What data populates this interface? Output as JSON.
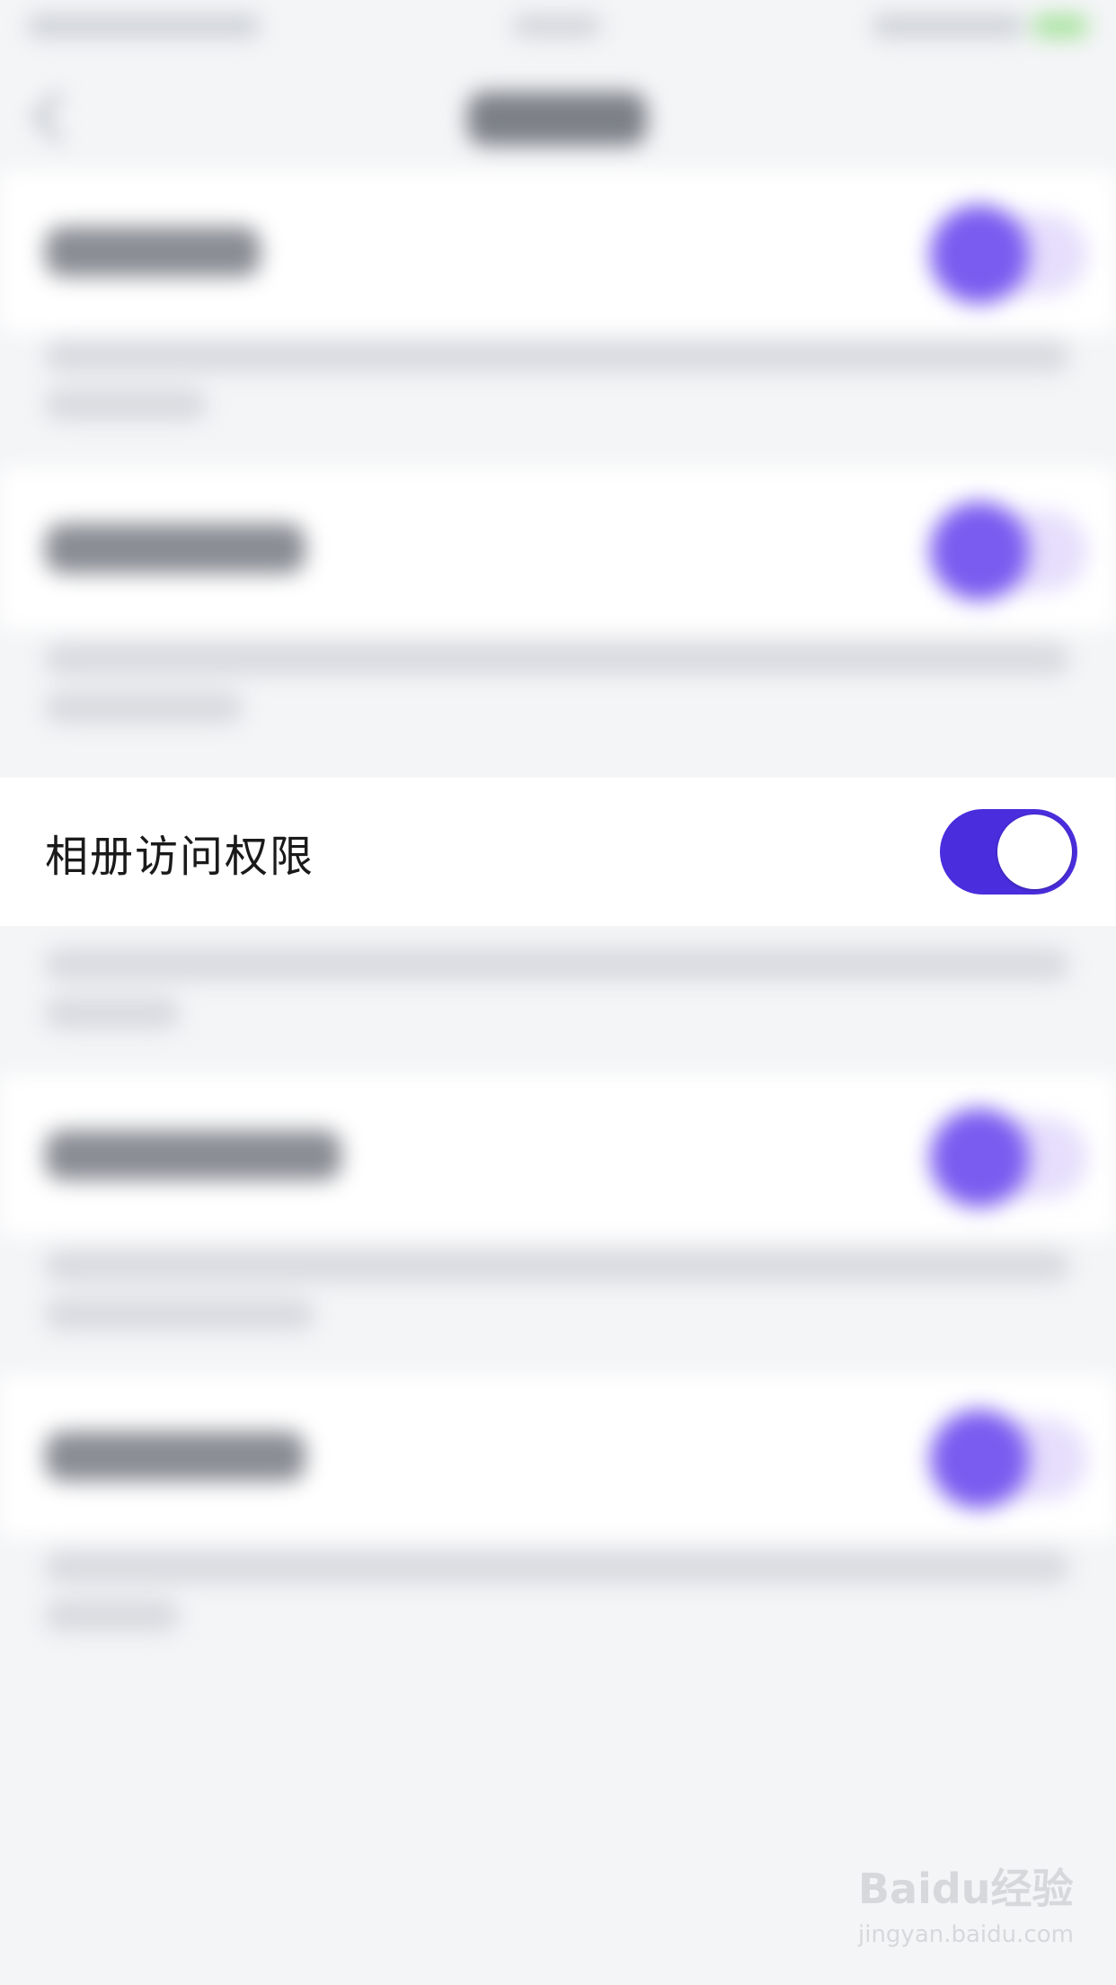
{
  "focused_setting": {
    "label": "相册访问权限",
    "enabled": true
  },
  "colors": {
    "toggle_on": "#4a2ddc",
    "toggle_knob": "#ffffff",
    "page_background": "#f4f5f7",
    "row_background": "#ffffff"
  },
  "watermark": {
    "brand": "Baidu经验",
    "url": "jingyan.baidu.com"
  }
}
